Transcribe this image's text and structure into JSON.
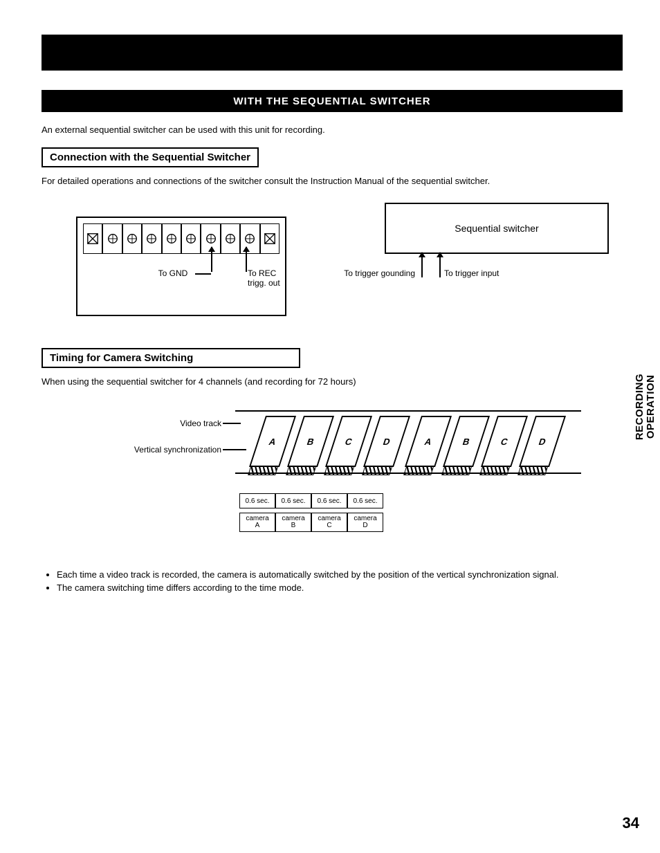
{
  "title_strip": "WITH THE SEQUENTIAL SWITCHER",
  "intro": "An external sequential switcher can be used with this unit for recording.",
  "section1_heading": "Connection with the Sequential Switcher",
  "section1_para": "For detailed operations and connections of the switcher consult the Instruction Manual of the sequential switcher.",
  "diagram1": {
    "switcher_box": "Sequential switcher",
    "to_gnd": "To GND",
    "to_rec": "To REC\ntrigg. out",
    "to_trig_gnd": "To trigger gounding",
    "to_trig_in": "To trigger input"
  },
  "section2_heading": "Timing for Camera Switching",
  "section2_para": "When using the sequential switcher for 4 channels (and recording for 72 hours)",
  "diagram2": {
    "video_track": "Video track",
    "vsync": "Vertical synchronization",
    "slots": [
      "A",
      "B",
      "C",
      "D",
      "A",
      "B",
      "C",
      "D"
    ],
    "time_cells": [
      "0.6 sec.",
      "0.6 sec.",
      "0.6 sec.",
      "0.6 sec."
    ],
    "cam_cells": [
      "camera\nA",
      "camera\nB",
      "camera\nC",
      "camera\nD"
    ]
  },
  "bullets": [
    "Each time a video track is recorded, the camera is automatically switched by the position of the vertical synchronization signal.",
    "The camera switching time differs according to the time mode."
  ],
  "page_number": "34",
  "side_label": "RECORDING\nOPERATION"
}
